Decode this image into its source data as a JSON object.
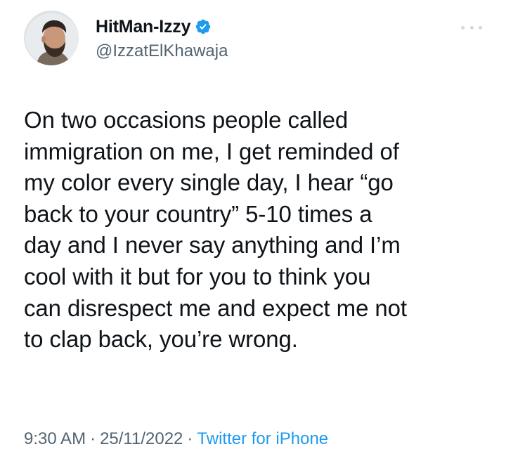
{
  "tweet": {
    "display_name": "HitMan-Izzy",
    "handle": "@IzzatElKhawaja",
    "verified": true,
    "verified_icon": "verified-badge-icon",
    "more_icon": "more-options-icon",
    "text": "On two occasions people called\nimmigration on me, I get reminded of\nmy color every single day, I hear “go\nback to your country” 5-10 times a\nday and I never say anything and I’m\ncool with it but for you to think you\ncan disrespect me and expect me not\nto clap back, you’re wrong.",
    "time": "9:30 AM",
    "separator": "·",
    "date": "25/11/2022",
    "source": "Twitter for iPhone"
  },
  "colors": {
    "text": "#0f1419",
    "secondary": "#536471",
    "link": "#1d9bf0",
    "verified": "#1d9bf0"
  }
}
